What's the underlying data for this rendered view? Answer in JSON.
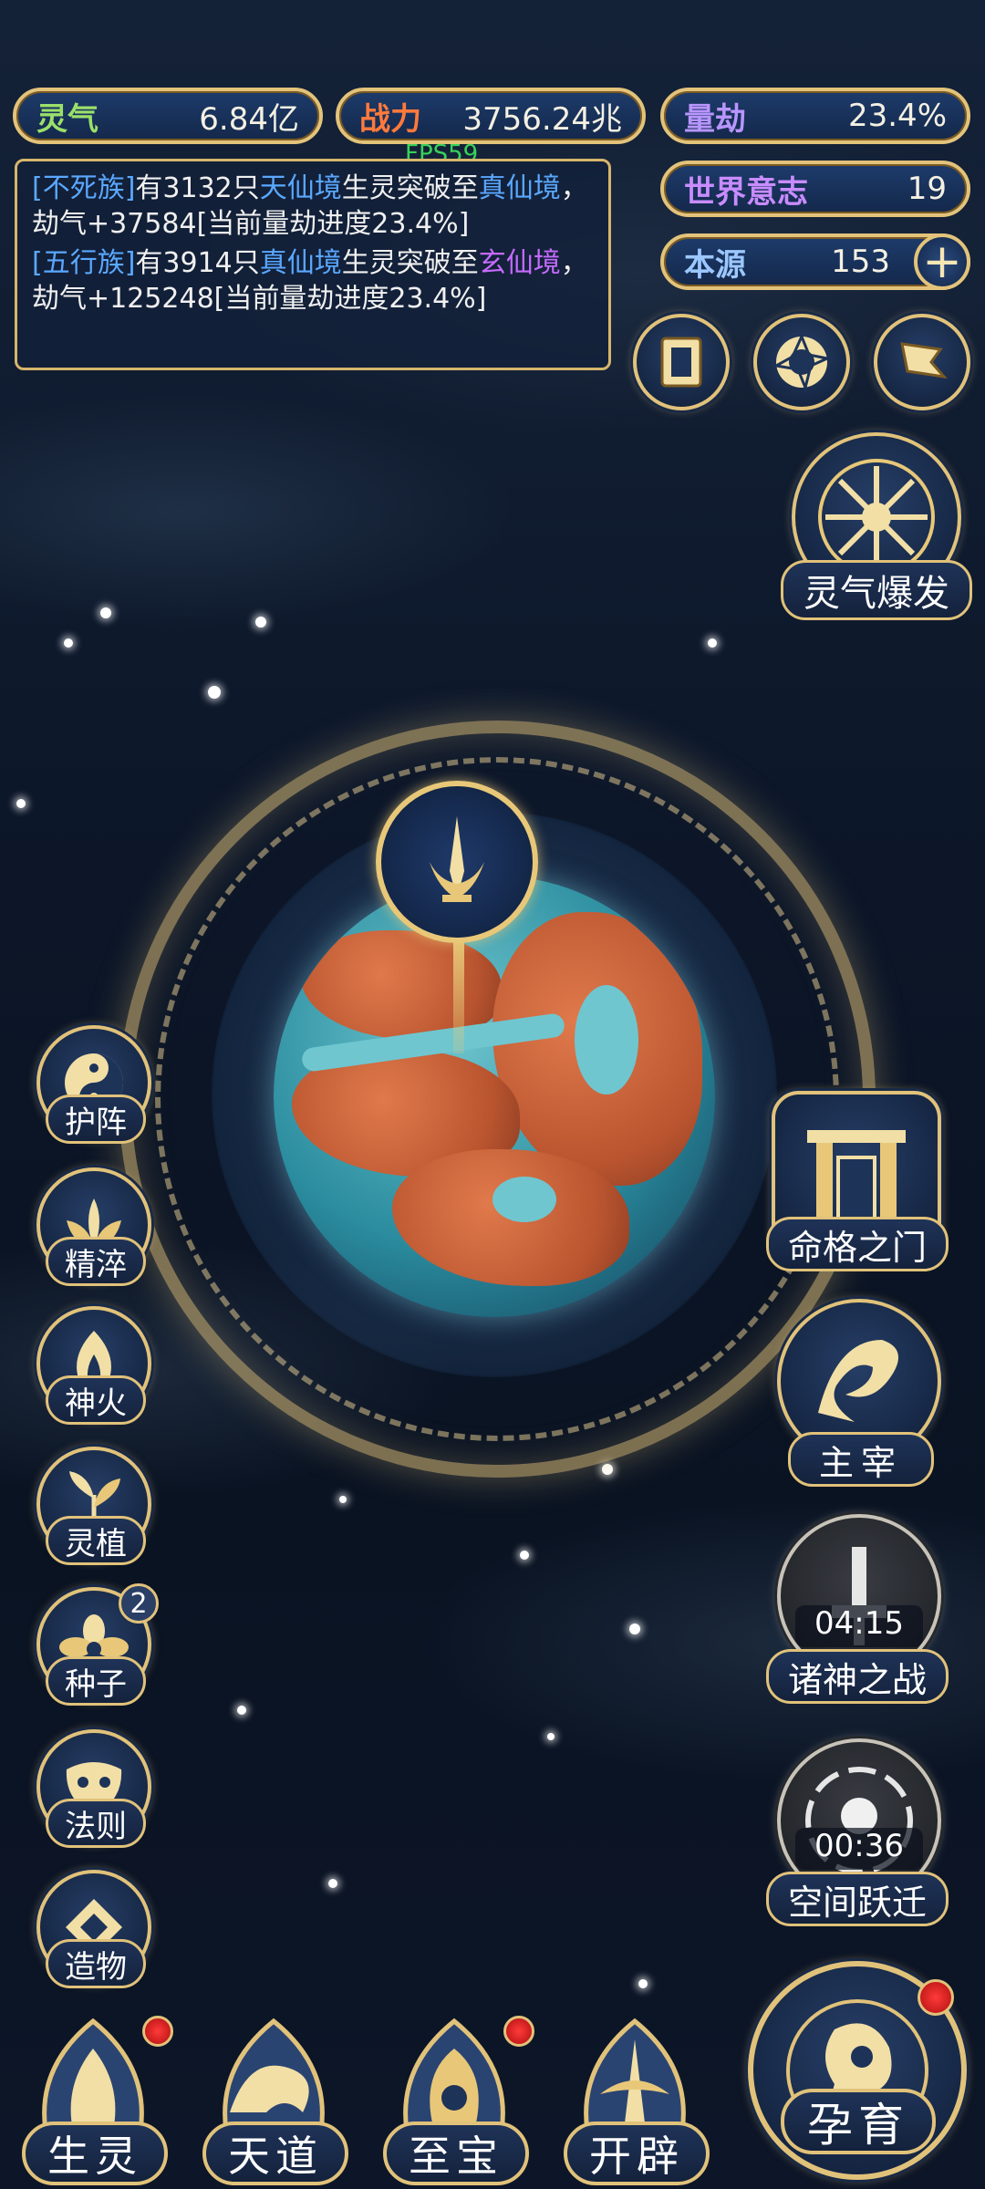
{
  "resources": {
    "lingqi": {
      "label": "灵气",
      "value": "6.84亿"
    },
    "zhanli": {
      "label": "战力",
      "value": "3756.24兆"
    },
    "liangjie": {
      "label": "量劫",
      "value": "23.4%"
    },
    "shijie": {
      "label": "世界意志",
      "value": "19"
    },
    "benyuan": {
      "label": "本源",
      "value": "153"
    }
  },
  "fps": "FPS59",
  "log": {
    "entries": [
      {
        "race": "[不死族]",
        "t1": "有3132只",
        "realm1": "天仙境",
        "t2": "生灵突破至",
        "realm2": "真仙境",
        "t3": "，劫气+37584[当前量劫进度23.4%]"
      },
      {
        "race": "[五行族]",
        "t1": "有3914只",
        "realm1": "真仙境",
        "t2": "生灵突破至",
        "realm2": "玄仙境",
        "t3": "，劫气+125248[当前量劫进度23.4%]"
      }
    ]
  },
  "right_actions": {
    "burst": "灵气爆发",
    "fate_gate": "命格之门",
    "ruler": "主宰",
    "god_war": {
      "label": "诸神之战",
      "timer": "04:15"
    },
    "space_jump": {
      "label": "空间跃迁",
      "timer": "00:36"
    }
  },
  "left_actions": [
    {
      "label": "护阵"
    },
    {
      "label": "精淬"
    },
    {
      "label": "神火"
    },
    {
      "label": "灵植"
    },
    {
      "label": "种子",
      "badge": "2"
    },
    {
      "label": "法则"
    },
    {
      "label": "造物"
    }
  ],
  "bottom_nav": [
    "生灵",
    "天道",
    "至宝",
    "开辟"
  ],
  "main_action": "孕育",
  "colors": {
    "gold": "#e1c27a",
    "panel": "#14284a",
    "accent_blue": "#5aa8ff",
    "accent_purple": "#c56bff"
  }
}
